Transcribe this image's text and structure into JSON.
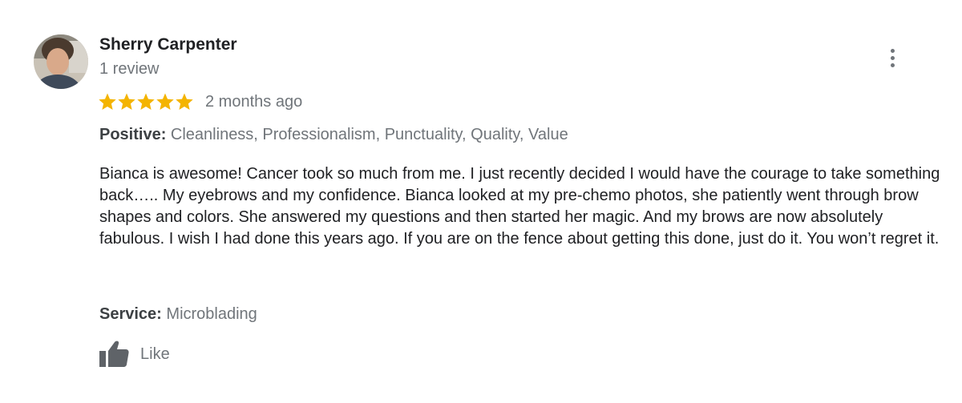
{
  "review": {
    "reviewer_name": "Sherry Carpenter",
    "review_count": "1 review",
    "rating": 5,
    "rating_max": 5,
    "time_ago": "2 months ago",
    "positive_label": "Positive:",
    "positive_value": "Cleanliness, Professionalism, Punctuality, Quality, Value",
    "text": "Bianca is awesome! Cancer took so much from me. I just recently decided I would have the courage to take something back….. My eyebrows and my confidence. Bianca looked at my pre-chemo photos, she patiently went through brow shapes and colors. She answered my questions and then started her magic. And my brows are now absolutely fabulous. I wish I had done this years ago. If you are on the fence about getting this done, just do it. You won’t regret it.",
    "service_label": "Service:",
    "service_value": "Microblading",
    "like_label": "Like"
  },
  "colors": {
    "star": "#f4b400",
    "secondary_text": "#70757a",
    "primary_text": "#202124"
  },
  "icons": {
    "avatar": "avatar-photo",
    "menu": "more-vertical-icon",
    "like": "thumbs-up-icon",
    "star": "star-icon"
  }
}
